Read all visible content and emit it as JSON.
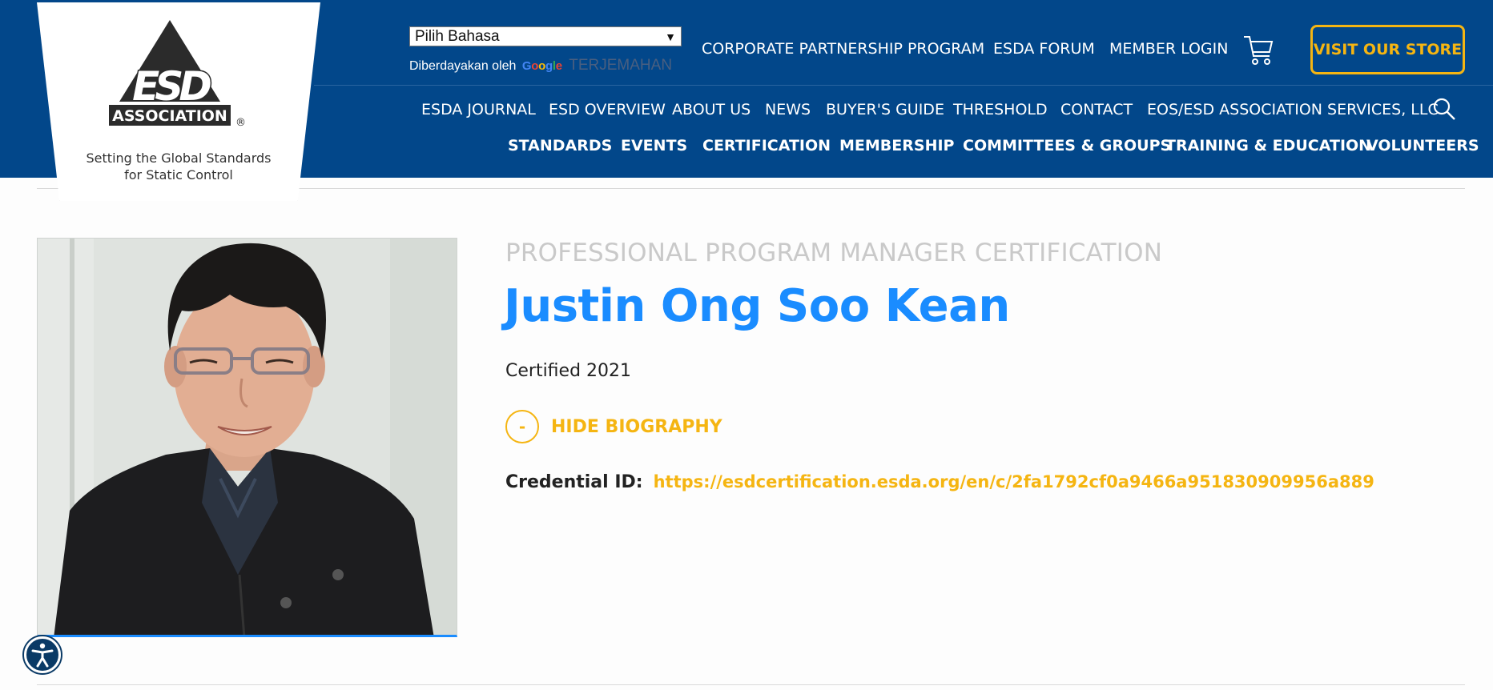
{
  "header": {
    "logo": {
      "wordmark": "ESD",
      "association": "ASSOCIATION",
      "registered": "®",
      "tagline": "Setting the Global Standards for Static Control"
    },
    "translate": {
      "select_value": "Pilih Bahasa",
      "powered_by": "Diberdayakan oleh",
      "google": [
        "G",
        "o",
        "o",
        "g",
        "l",
        "e"
      ],
      "translate_link": "TERJEMAHAN"
    },
    "top_nav": [
      {
        "label": "CORPORATE PARTNERSHIP PROGRAM"
      },
      {
        "label": "ESDA FORUM"
      },
      {
        "label": "MEMBER LOGIN"
      }
    ],
    "store_button": "VISIT OUR STORE",
    "nav2": [
      {
        "label": "ESDA JOURNAL"
      },
      {
        "label": "ESD OVERVIEW"
      },
      {
        "label": "ABOUT US"
      },
      {
        "label": "NEWS"
      },
      {
        "label": "BUYER'S GUIDE"
      },
      {
        "label": "THRESHOLD"
      },
      {
        "label": "CONTACT"
      },
      {
        "label": "EOS/ESD ASSOCIATION SERVICES, LLC"
      }
    ],
    "nav3": [
      {
        "label": "STANDARDS"
      },
      {
        "label": "EVENTS"
      },
      {
        "label": "CERTIFICATION"
      },
      {
        "label": "MEMBERSHIP"
      },
      {
        "label": "COMMITTEES & GROUPS"
      },
      {
        "label": "TRAINING & EDUCATION"
      },
      {
        "label": "VOLUNTEERS"
      }
    ]
  },
  "profile": {
    "certification_type": "PROFESSIONAL PROGRAM MANAGER CERTIFICATION",
    "name": "Justin Ong Soo Kean",
    "certified": "Certified 2021",
    "bio_toggle_symbol": "-",
    "bio_toggle_label": "HIDE BIOGRAPHY",
    "credential_label": "Credential ID:",
    "credential_url": "https://esdcertification.esda.org/en/c/2fa1792cf0a9466a951830909956a889"
  },
  "icons": {
    "cart": "shopping-cart-icon",
    "search": "search-icon",
    "accessibility": "accessibility-icon"
  },
  "colors": {
    "brand_blue": "#02478a",
    "accent_yellow": "#f5b512",
    "name_blue": "#1a8cff"
  }
}
